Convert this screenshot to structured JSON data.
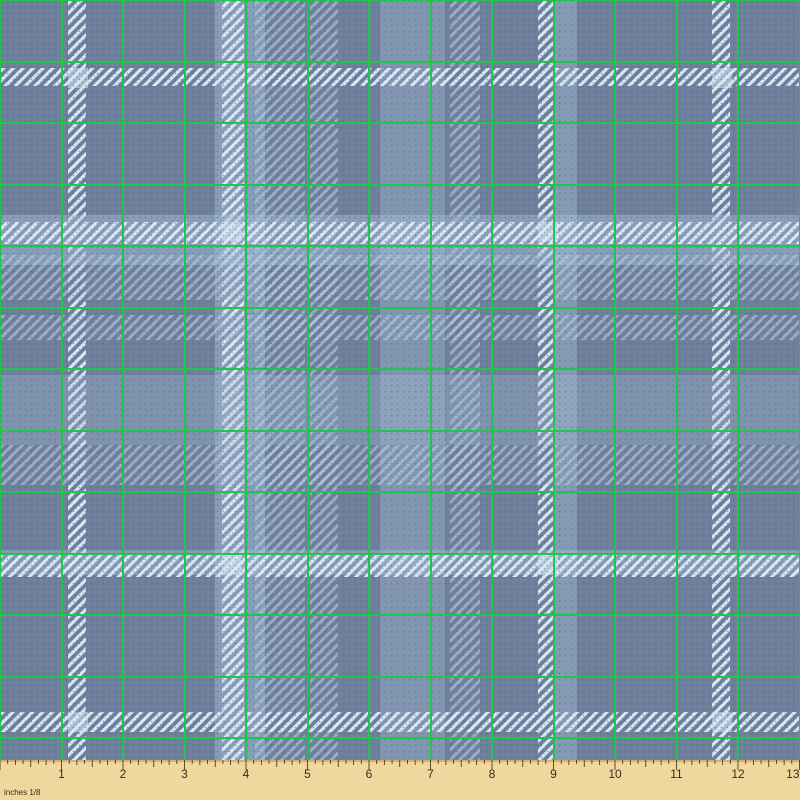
{
  "swatch": {
    "colors": {
      "base": "#6d7f9a",
      "base_dark": "#5f7190",
      "light_band": "#a9c3dc",
      "pale_stripe": "#dbe9f6",
      "grid_line": "#1ec64a"
    },
    "pattern": "blue-grey tartan plaid with light twill stripes"
  },
  "ruler": {
    "unit_label": "inches 1/8",
    "numbers": [
      "1",
      "2",
      "3",
      "4",
      "5",
      "6",
      "7",
      "8",
      "9",
      "10",
      "11",
      "12",
      "13"
    ],
    "colors": {
      "wood": "#efd79e",
      "wood_edge": "#cfb273",
      "ink": "#3a2e1a"
    }
  }
}
